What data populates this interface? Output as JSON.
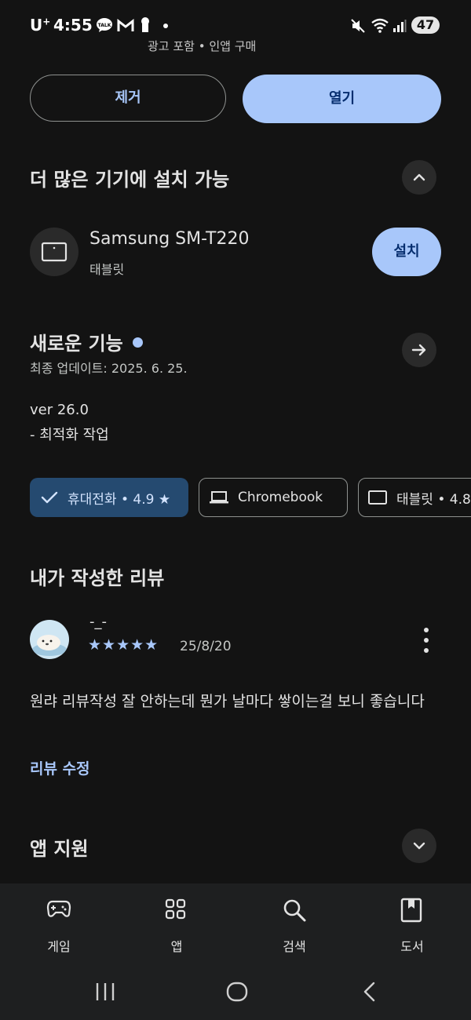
{
  "status_bar": {
    "carrier": "U",
    "carrier_sup": "+",
    "time": "4:55",
    "battery": "47"
  },
  "cut_text": "광고 포함 • 인앱 구매",
  "actions": {
    "remove": "제거",
    "open": "열기"
  },
  "more_devices": {
    "title": "더 많은 기기에 설치 가능",
    "device_name": "Samsung SM-T220",
    "device_type": "태블릿",
    "install": "설치"
  },
  "whats_new": {
    "title": "새로운 기능",
    "updated": "최종 업데이트: 2025. 6. 25.",
    "notes": "ver 26.0\n- 최적화 작업"
  },
  "chips": {
    "phone": "휴대전화 • 4.9 ★",
    "chromebook": "Chromebook",
    "tablet": "태블릿 • 4.8"
  },
  "my_review": {
    "title": "내가 작성한 리뷰",
    "reviewer": "-_-",
    "stars": "★★★★★",
    "rating": 5,
    "date": "25/8/20",
    "text": "원랴 리뷰작성 잘 안하는데 뭔가 날마다 쌓이는걸 보니 좋습니다",
    "edit": "리뷰 수정"
  },
  "app_support": {
    "title": "앱 지원"
  },
  "bottom_nav": {
    "games": "게임",
    "apps": "앱",
    "search": "검색",
    "books": "도서"
  },
  "colors": {
    "accent": "#a8c7fa",
    "background": "#131313",
    "chip_selected": "#254a70"
  }
}
